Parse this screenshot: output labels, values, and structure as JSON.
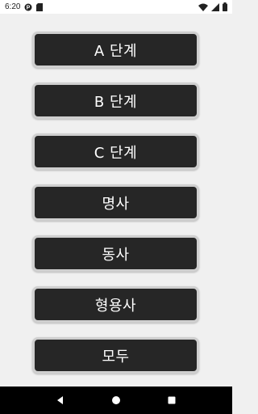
{
  "status_bar": {
    "time": "6:20",
    "icons": [
      "notification-p-icon",
      "sd-card-icon",
      "wifi-icon",
      "signal-icon",
      "battery-icon"
    ]
  },
  "menu": {
    "items": [
      {
        "label": "A 단계"
      },
      {
        "label": "B 단계"
      },
      {
        "label": "C 단계"
      },
      {
        "label": "명사"
      },
      {
        "label": "동사"
      },
      {
        "label": "형용사"
      },
      {
        "label": "모두"
      }
    ]
  },
  "nav_bar": {
    "buttons": [
      "back-icon",
      "home-icon",
      "recents-icon"
    ]
  },
  "colors": {
    "button_bg": "#262626",
    "button_border": "#cfcfcf",
    "page_bg": "#f0f0f0",
    "text": "#ffffff"
  }
}
